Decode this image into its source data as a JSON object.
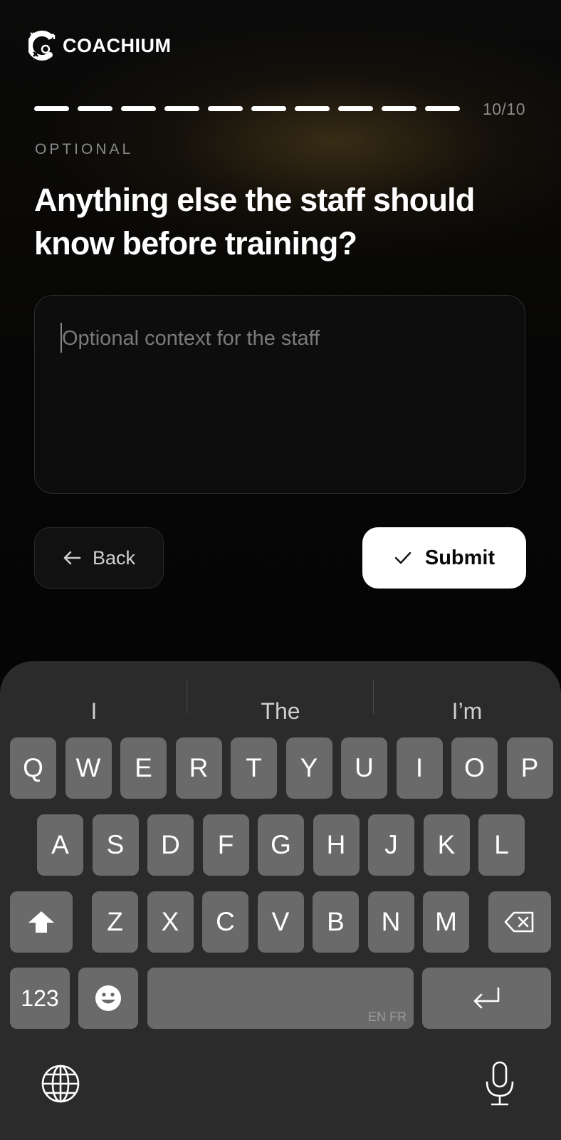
{
  "app": {
    "brand": "COACHIUM"
  },
  "progress": {
    "total": 10,
    "completed": 10,
    "label": "10/10"
  },
  "question": {
    "eyebrow": "OPTIONAL",
    "title": "Anything else the staff should know before training?"
  },
  "context_field": {
    "value": "",
    "placeholder": "Optional context for the staff"
  },
  "actions": {
    "back_label": "Back",
    "submit_label": "Submit"
  },
  "keyboard": {
    "suggestions": [
      "I",
      "The",
      "I’m"
    ],
    "row1": [
      "Q",
      "W",
      "E",
      "R",
      "T",
      "Y",
      "U",
      "I",
      "O",
      "P"
    ],
    "row2": [
      "A",
      "S",
      "D",
      "F",
      "G",
      "H",
      "J",
      "K",
      "L"
    ],
    "row3": [
      "Z",
      "X",
      "C",
      "V",
      "B",
      "N",
      "M"
    ],
    "numbers_label": "123",
    "space_languages": "EN FR",
    "icons": [
      "shift-icon",
      "backspace-icon",
      "emoji-icon",
      "return-icon",
      "globe-icon",
      "microphone-icon"
    ]
  },
  "colors": {
    "background": "#050505",
    "accent": "#ffffff",
    "muted": "#8a8a8a",
    "keyboard": "#2b2b2b",
    "key": "#6a6a6a"
  }
}
